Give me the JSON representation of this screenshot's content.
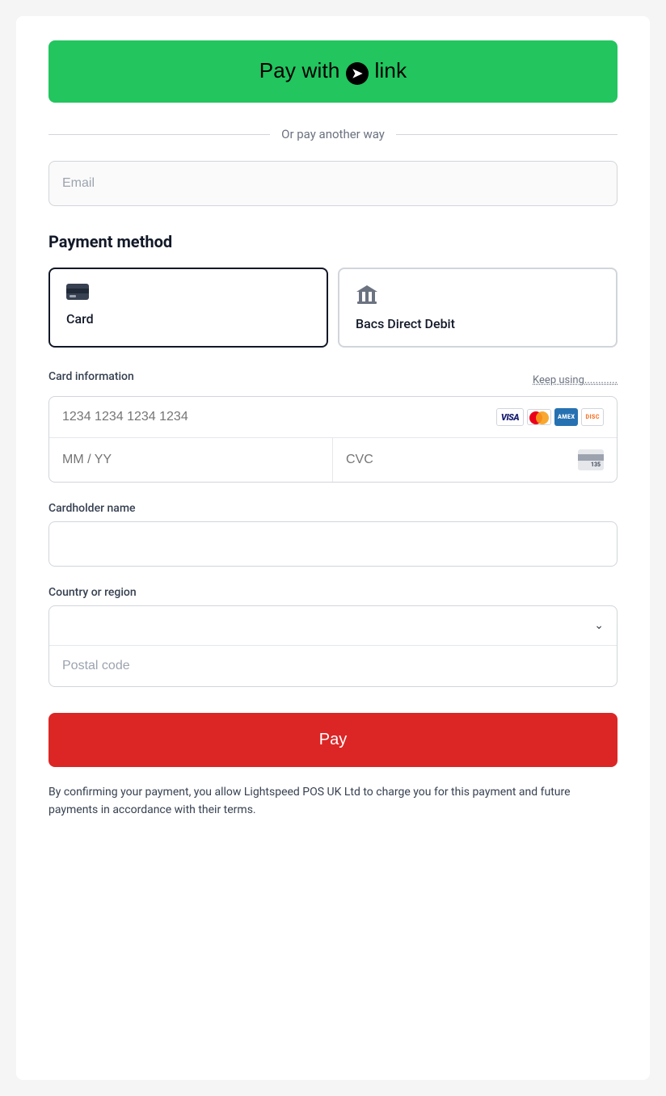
{
  "header": {
    "pay_with_link_label": "Pay with",
    "link_text": "link"
  },
  "divider": {
    "text": "Or pay another way"
  },
  "email": {
    "placeholder": "Email"
  },
  "payment_method_section": {
    "title": "Payment method",
    "options": [
      {
        "id": "card",
        "label": "Card",
        "selected": true
      },
      {
        "id": "bacs",
        "label": "Bacs Direct Debit",
        "selected": false
      }
    ]
  },
  "card_information": {
    "label": "Card information",
    "keep_using_text": "Keep using............",
    "card_number_placeholder": "1234 1234 1234 1234",
    "mm_yy_placeholder": "MM / YY",
    "cvc_placeholder": "CVC",
    "cvc_sample": "135"
  },
  "cardholder": {
    "label": "Cardholder name",
    "placeholder": ""
  },
  "country": {
    "label": "Country or region",
    "postal_placeholder": "Postal code"
  },
  "pay_button": {
    "label": "Pay"
  },
  "consent_text": "By confirming your payment, you allow Lightspeed POS UK Ltd to charge you for this payment and future payments in accordance with their terms.",
  "colors": {
    "link_green": "#22c55e",
    "pay_red": "#dc2626",
    "selected_border": "#111827"
  }
}
